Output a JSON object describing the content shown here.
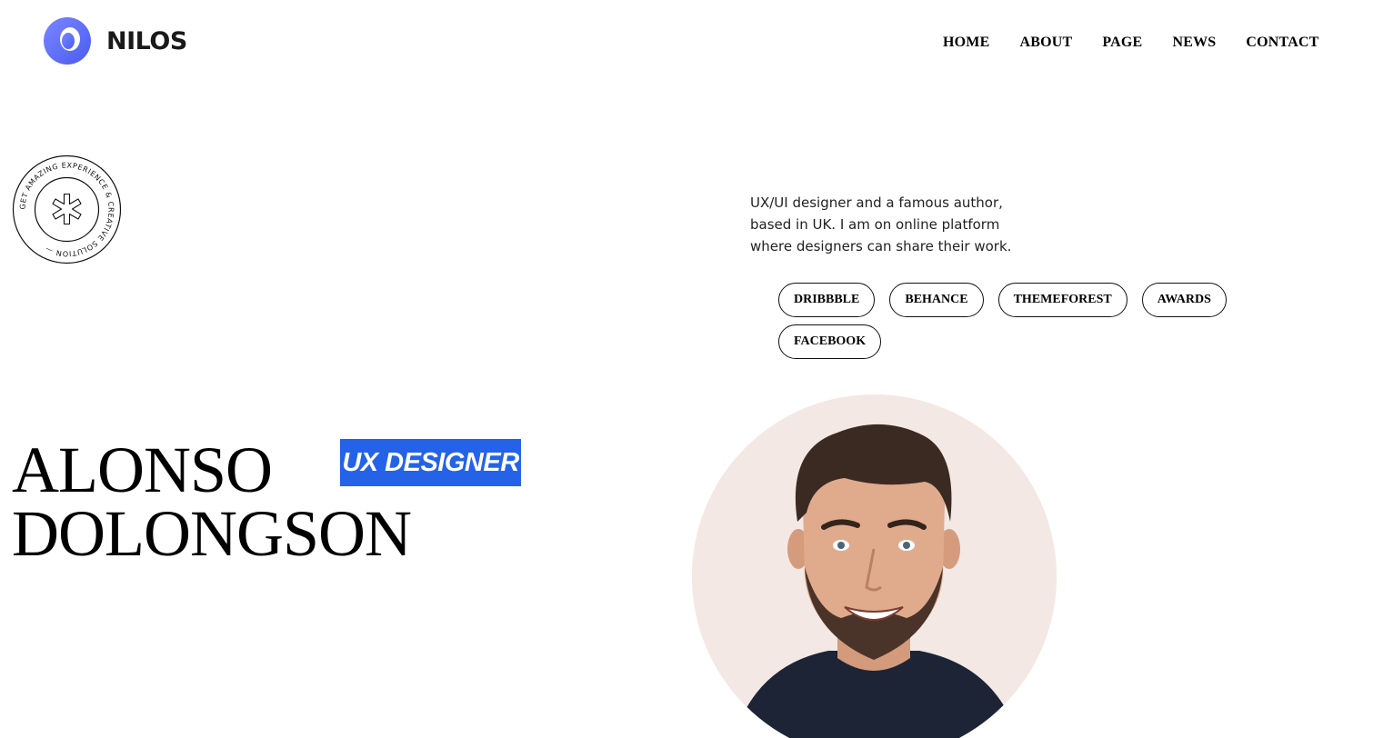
{
  "brand": {
    "name": "NILOS",
    "logo_icon": "ring-logo-icon",
    "accent": "#5b6cf5"
  },
  "nav": {
    "items": [
      {
        "label": "HOME"
      },
      {
        "label": "ABOUT"
      },
      {
        "label": "PAGE"
      },
      {
        "label": "NEWS"
      },
      {
        "label": "CONTACT"
      }
    ]
  },
  "badge": {
    "text": "GET AMAZING EXPERIENCE & CREATIVE SOLUTION  — ",
    "icon": "asterisk-icon"
  },
  "hero": {
    "bio": "UX/UI designer and a famous author, based in UK. I am on online platform where designers can share their work.",
    "socials": [
      {
        "label": "DRIBBBLE"
      },
      {
        "label": "BEHANCE"
      },
      {
        "label": "THEMEFOREST"
      },
      {
        "label": "AWARDS"
      },
      {
        "label": "FACEBOOK"
      }
    ],
    "first_name": "ALONSO",
    "last_name": "DOLONGSON",
    "role": "UX DESIGNER",
    "role_color": "#2463e8",
    "portrait_bg": "#f3e8e4"
  }
}
